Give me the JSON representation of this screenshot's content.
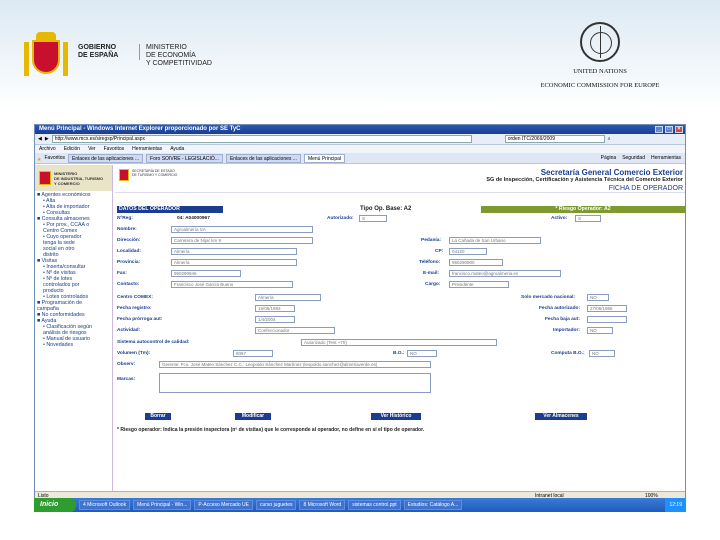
{
  "slide": {
    "gov_line1": "GOBIERNO\nDE ESPAÑA",
    "gov_line2": "MINISTERIO\nDE ECONOMÍA\nY COMPETITIVIDAD",
    "un_line1": "UNITED NATIONS",
    "un_line2": "ECONOMIC COMMISSION FOR EUROPE"
  },
  "browser": {
    "title": "Menú Principal - Windows Internet Explorer proporcionado por SE TyC",
    "url": "http://www.mcx.es/siregsp/Principal.aspx",
    "search": "orden ITC/2069/2009",
    "menu": [
      "Archivo",
      "Edición",
      "Ver",
      "Favoritos",
      "Herramientas",
      "Ayuda"
    ],
    "favoritos": "Favoritos",
    "tabs": [
      "Enlaces de las aplicaciones ...",
      "Foro SOIVRE - LEGISLACIÓ...",
      "Enlaces de las aplicaciones ...",
      "Menú Principal"
    ],
    "tools": [
      "Página",
      "Seguridad",
      "Herramientas"
    ],
    "status": "Listo",
    "zone": "Intranet local",
    "zoom": "100%"
  },
  "sidebar": {
    "logo": "MINISTERIO\nDE INDUSTRIA, TURISMO\nY COMERCIO",
    "items": [
      {
        "label": "Agentes económicos",
        "level": 1
      },
      {
        "label": "Alta",
        "level": 2
      },
      {
        "label": "Alta de importador",
        "level": 2
      },
      {
        "label": "Consultas",
        "level": 2
      },
      {
        "label": "Consulta almacenes",
        "level": 1
      },
      {
        "label": "Por prov., CCAA o\nCentro Comex",
        "level": 2
      },
      {
        "label": "Cuyo operador\ntenga la sede\nsocial en otro\ndistrito",
        "level": 2
      },
      {
        "label": "Visitas",
        "level": 1
      },
      {
        "label": "Inserta/consultar",
        "level": 2
      },
      {
        "label": "Nº de visitas",
        "level": 2
      },
      {
        "label": "Nº de lotes\ncontrolados por\nproducto",
        "level": 2
      },
      {
        "label": "Lotes controlados",
        "level": 2
      },
      {
        "label": "Programación de\ncampaña",
        "level": 1
      },
      {
        "label": "No conformidades",
        "level": 1
      },
      {
        "label": "Ayuda",
        "level": 1
      },
      {
        "label": "Clasificación según\nanálisis de riesgos",
        "level": 2
      },
      {
        "label": "Manual de usuario",
        "level": 2
      },
      {
        "label": "Novedades",
        "level": 2
      }
    ]
  },
  "header": {
    "logo": "SECRETARÍA DE ESTADO\nDE TURISMO Y COMERCIO",
    "title1": "Secretaría General Comercio Exterior",
    "title2": "SG de Inspección, Certificación y Asistencia Técnica del Comercio Exterior",
    "title3": "FICHA DE OPERADOR"
  },
  "form": {
    "sec_datos": "DATOS DEL OPERADOR",
    "tipo_op": "Tipo Op. Base: A2",
    "riesgo": "* Riesgo Operador: A2",
    "nreg_label": "NºReg:",
    "nreg_value": "04: A04000967",
    "autorizado_label": "Autorizado:",
    "autorizado_value": "S",
    "activo_label": "Activo:",
    "activo_value": "S",
    "nombre_label": "Nombre:",
    "nombre_value": "Agroalmería SA",
    "direccion_label": "Dirección:",
    "direccion_value": "Carretera de Níjar km 9",
    "pedania_label": "Pedanía:",
    "pedania_value": "La Cañada de San Urbano",
    "localidad_label": "Localidad:",
    "localidad_value": "Almería",
    "cp_label": "CP:",
    "cp_value": "04120",
    "provincia_label": "Provincia:",
    "provincia_value": "Almería",
    "telefono_label": "Teléfono:",
    "telefono_value": "950290900",
    "fax_label": "Fax:",
    "fax_value": "950290946",
    "email_label": "E-mail:",
    "email_value": "francisco.mateo@agroalmeria.es",
    "contacto_label": "Contacto:",
    "contacto_value": "Francisco José García Bueno",
    "cargo_label": "Cargo:",
    "cargo_value": "Presidente",
    "comex_label": "Centro COMEX:",
    "comex_value": "Almería",
    "solo_label": "Solo mercado nacional:",
    "solo_value": "NO",
    "freg_label": "Fecha registro:",
    "freg_value": "15/06/1983",
    "faut_label": "Fecha autorizado:",
    "faut_value": "27/06/1986",
    "fprorroga_label": "Fecha prórroga aut:",
    "fprorroga_value": "1/4/2004",
    "fbaja_label": "Fecha baja aut:",
    "fbaja_value": "",
    "actividad_label": "Actividad:",
    "actividad_value": "Confeccionador",
    "importador_label": "Importador:",
    "importador_value": "NO",
    "sistema_label": "Sistema autocontrol de calidad:",
    "sistema_value": "Autorizado (Test +70)",
    "volumen_label": "Volumen (Tm):",
    "volumen_value": "8067",
    "bo_label": "B.O.:",
    "bo_value": "NO",
    "compute_label": "Computa B.O.:",
    "compute_value": "NO",
    "observ_label": "Observ:",
    "observ_value": "Gerente: Fco. José Mateo Sánchez C.C.: Leopoldo Sánchez Martínez (leopoldo.sanchez@almeriaverde.es)",
    "marcas_label": "Marcas:",
    "buttons": [
      "Borrar",
      "Modificar",
      "Ver Histórico",
      "Ver Almacenes"
    ],
    "note": "* Riesgo operador: Indica la presión inspectora (nº de visitas) que le corresponde al operador, no define en sí el tipo de operador."
  },
  "taskbar": {
    "start": "Inicio",
    "items": [
      "4 Microsoft Outlook",
      "Menú Principal - Win...",
      "P-Acceso Mercado UE",
      "curso juguetes",
      "8 Microsoft Word",
      "sistemas control.ppt",
      "Estudios: Catálogo A..."
    ],
    "clock": "12:19"
  }
}
